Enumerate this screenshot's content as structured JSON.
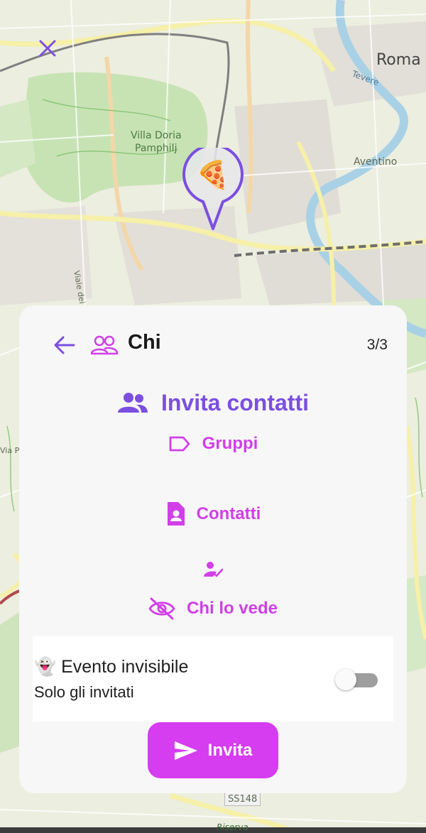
{
  "map": {
    "labels": {
      "roma": "Roma",
      "villa_line1": "Villa Doria",
      "villa_line2": "Pamphilj",
      "viale": "Viale dei Colli Portu",
      "tevere": "Tevere",
      "aventino": "Aventino",
      "via": "Via P",
      "ss148": "SS148",
      "riserva": "Riserva"
    },
    "pin": {
      "emoji": "🍕",
      "color": "#7b4fe0",
      "icon": "pizza-marker-icon"
    }
  },
  "close": {
    "icon": "close-icon",
    "color": "#7b4fe0"
  },
  "sheet": {
    "header": {
      "title": "Chi",
      "step": "3/3",
      "back_icon": "arrow-left-icon",
      "people_icon": "people-outline-icon"
    },
    "section_title": {
      "label": "Invita contatti",
      "icon": "group-icon",
      "color": "#7b4fe0"
    },
    "groups": {
      "label": "Gruppi",
      "icon": "label-tag-icon"
    },
    "contacts": {
      "label": "Contatti",
      "icon": "contact-page-icon"
    },
    "selected_icon": "person-check-icon",
    "visibility": {
      "label": "Chi lo vede",
      "icon": "eye-off-icon"
    },
    "invisible_event": {
      "emoji": "👻",
      "title": "Evento invisibile",
      "subtitle": "Solo gli invitati",
      "toggle_on": false
    },
    "invite_button": {
      "label": "Invita",
      "icon": "send-icon",
      "color": "#d63cf0"
    },
    "accent_color": "#d13fe8"
  }
}
